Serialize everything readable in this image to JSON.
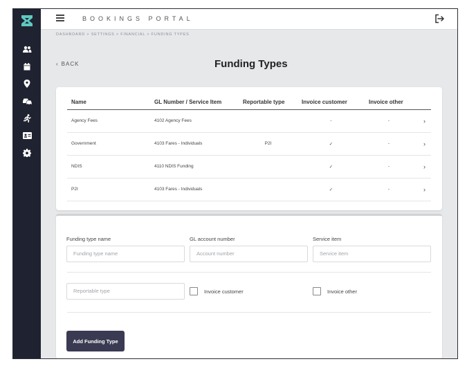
{
  "header": {
    "portal_title": "BOOKINGS PORTAL",
    "menu_icon": "hamburger-icon",
    "logout_icon": "logout-icon"
  },
  "sidebar": {
    "logo_icon": "logo-icon",
    "items": [
      {
        "icon": "users-icon"
      },
      {
        "icon": "calendar-icon"
      },
      {
        "icon": "location-pin-icon"
      },
      {
        "icon": "vehicles-icon"
      },
      {
        "icon": "runner-icon"
      },
      {
        "icon": "id-card-icon"
      },
      {
        "icon": "gear-icon"
      }
    ]
  },
  "breadcrumb": "DASHBOARD  >  SETTINGS  >  FINANCIAL  >  FUNDING TYPES",
  "back_label": "BACK",
  "page_title": "Funding Types",
  "table": {
    "headers": [
      "Name",
      "GL Number / Service Item",
      "Reportable type",
      "Invoice customer",
      "Invoice other"
    ],
    "rows": [
      {
        "name": "Agency Fees",
        "gl": "4102 Agency Fees",
        "reportable": "",
        "invoice_customer": "-",
        "invoice_other": "-"
      },
      {
        "name": "Government",
        "gl": "4103 Fares - Individuals",
        "reportable": "P2I",
        "invoice_customer": "✓",
        "invoice_other": "-"
      },
      {
        "name": "NDIS",
        "gl": "4110 NDIS Funding",
        "reportable": "",
        "invoice_customer": "✓",
        "invoice_other": "-"
      },
      {
        "name": "P2I",
        "gl": "4103 Fares - Individuals",
        "reportable": "",
        "invoice_customer": "✓",
        "invoice_other": "-"
      }
    ]
  },
  "form": {
    "funding_type_name_label": "Funding type name",
    "funding_type_name_placeholder": "Funding type name",
    "gl_account_label": "GL account number",
    "gl_account_placeholder": "Account number",
    "service_item_label": "Service item",
    "service_item_placeholder": "Service item",
    "reportable_type_placeholder": "Reportable type",
    "invoice_customer_label": "Invoice customer",
    "invoice_other_label": "Invoice other",
    "submit_label": "Add Funding Type"
  },
  "colors": {
    "sidebar_bg": "#1f2230",
    "button_bg": "#3a3a53",
    "page_bg": "#e6e8ea"
  }
}
